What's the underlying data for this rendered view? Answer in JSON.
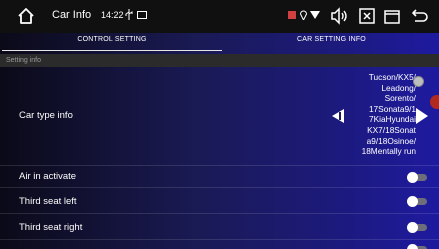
{
  "status_bar": {
    "title": "Car Info",
    "time": "14:22",
    "icons": [
      "home-icon",
      "usb-icon",
      "cast-icon",
      "sim-icon",
      "location-icon",
      "wifi-icon",
      "volume-icon",
      "close-box-icon",
      "recent-apps-icon",
      "back-icon"
    ]
  },
  "tabs": [
    {
      "label": "CONTROL SETTING",
      "active": true
    },
    {
      "label": "CAR SETTING INFO",
      "active": false
    }
  ],
  "section": {
    "title": "Setting info"
  },
  "rows": {
    "car_type": {
      "label": "Car type info",
      "value": "Tucson/KX5/\nLeadong/\nSorento/\n17Sonata9/1\n7KiaHyundai\nKX7/18Sonat\na9/18Osinoe/\n18Mentally run"
    },
    "air_in_activate": {
      "label": "Air in activate",
      "on": false
    },
    "third_seat_left": {
      "label": "Third seat left",
      "on": false
    },
    "third_seat_right": {
      "label": "Third seat right",
      "on": false
    }
  },
  "colors": {
    "background_start": "#0b0a18",
    "background_end": "#1e1aa0",
    "status_bar": "#101010",
    "section_header": "#2b2b2b",
    "toggle_off": "#6e6e7a"
  }
}
